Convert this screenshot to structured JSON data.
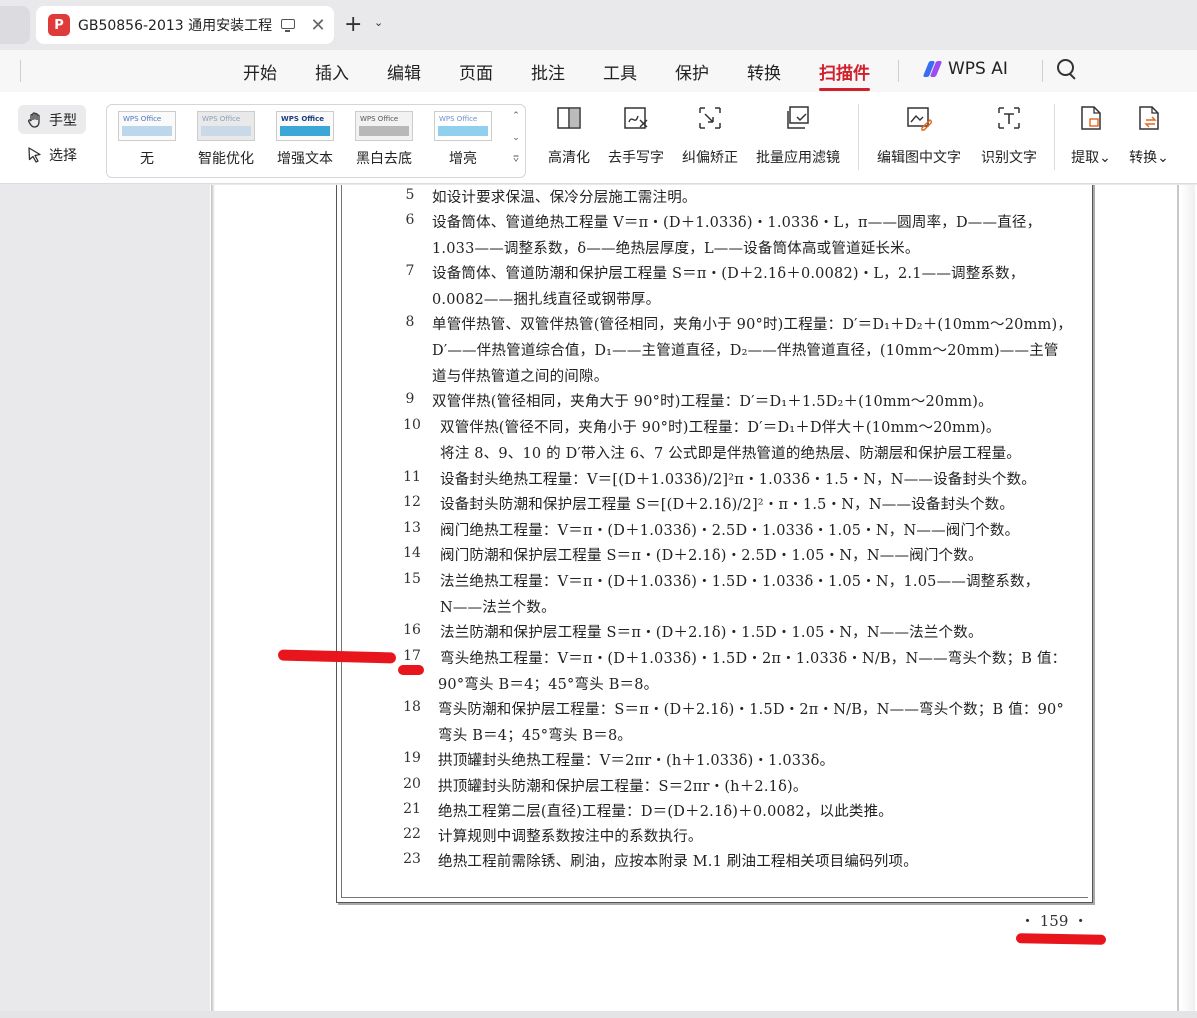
{
  "tab": {
    "title": "GB50856-2013 通用安装工程",
    "close": "✕",
    "new_tab": "+",
    "new_tab_drop": "⌄"
  },
  "menu": {
    "items": [
      "开始",
      "插入",
      "编辑",
      "页面",
      "批注",
      "工具",
      "保护",
      "转换",
      "扫描件"
    ],
    "active": "扫描件",
    "ai_label": "WPS AI"
  },
  "toolbar": {
    "hand": "手型",
    "select": "选择",
    "filter_logo": "WPS Office",
    "filters": [
      "无",
      "智能优化",
      "增强文本",
      "黑白去底",
      "增亮"
    ],
    "scroll_up": "⌃",
    "scroll_down": "⌄",
    "scroll_more": "⩢",
    "tools": [
      "高清化",
      "去手写字",
      "纠偏矫正",
      "批量应用滤镜",
      "编辑图中文字",
      "识别文字",
      "提取⌄",
      "转换⌄"
    ]
  },
  "document": {
    "lines": [
      {
        "n": "5",
        "text": "如设计要求保温、保冷分层施工需注明。"
      },
      {
        "n": "6",
        "text": "设备筒体、管道绝热工程量 V＝π・(D＋1.033δ)・1.033δ・L，π——圆周率，D——直径，"
      },
      {
        "n": "",
        "text": "1.033——调整系数，δ——绝热层厚度，L——设备筒体高或管道延长米。"
      },
      {
        "n": "7",
        "text": "设备筒体、管道防潮和保护层工程量 S＝π・(D＋2.1δ＋0.0082)・L，2.1——调整系数，"
      },
      {
        "n": "",
        "text": "0.0082——捆扎线直径或钢带厚。"
      },
      {
        "n": "8",
        "text": "单管伴热管、双管伴热管(管径相同，夹角小于 90°时)工程量：D′＝D₁＋D₂＋(10mm～20mm)，"
      },
      {
        "n": "",
        "text": "D′——伴热管道综合值，D₁——主管道直径，D₂——伴热管道直径，(10mm～20mm)——主管"
      },
      {
        "n": "",
        "text": "道与伴热管道之间的间隙。"
      },
      {
        "n": "9",
        "text": "双管伴热(管径相同，夹角大于 90°时)工程量：D′＝D₁＋1.5D₂＋(10mm～20mm)。"
      },
      {
        "n": "10",
        "text": "双管伴热(管径不同，夹角小于 90°时)工程量：D′＝D₁＋D伴大＋(10mm～20mm)。"
      },
      {
        "n": "",
        "text": "将注 8、9、10 的 D′带入注 6、7 公式即是伴热管道的绝热层、防潮层和保护层工程量。"
      },
      {
        "n": "11",
        "text": "设备封头绝热工程量：V＝[(D＋1.033δ)/2]²π・1.033δ・1.5・N，N——设备封头个数。"
      },
      {
        "n": "12",
        "text": "设备封头防潮和保护层工程量 S＝[(D＋2.1δ)/2]²・π・1.5・N，N——设备封头个数。"
      },
      {
        "n": "13",
        "text": "阀门绝热工程量：V＝π・(D＋1.033δ)・2.5D・1.033δ・1.05・N，N——阀门个数。"
      },
      {
        "n": "14",
        "text": "阀门防潮和保护层工程量 S＝π・(D＋2.1δ)・2.5D・1.05・N，N——阀门个数。"
      },
      {
        "n": "15",
        "text": "法兰绝热工程量：V＝π・(D＋1.033δ)・1.5D・1.033δ・1.05・N，1.05——调整系数，"
      },
      {
        "n": "",
        "text": "N——法兰个数。"
      },
      {
        "n": "16",
        "text": "法兰防潮和保护层工程量 S＝π・(D＋2.1δ)・1.5D・1.05・N，N——法兰个数。"
      },
      {
        "n": "17",
        "text": "弯头绝热工程量：V＝π・(D＋1.033δ)・1.5D・2π・1.033δ・N/B，N——弯头个数；B 值："
      },
      {
        "n": "",
        "text": "90°弯头 B＝4；45°弯头 B＝8。"
      },
      {
        "n": "18",
        "text": "弯头防潮和保护层工程量：S＝π・(D＋2.1δ)・1.5D・2π・N/B，N——弯头个数；B 值：90°"
      },
      {
        "n": "",
        "text": "弯头 B＝4；45°弯头 B＝8。"
      },
      {
        "n": "19",
        "text": "拱顶罐封头绝热工程量：V＝2πr・(h＋1.033δ)・1.033δ。"
      },
      {
        "n": "20",
        "text": "拱顶罐封头防潮和保护层工程量：S＝2πr・(h＋2.1δ)。"
      },
      {
        "n": "21",
        "text": "绝热工程第二层(直径)工程量：D＝(D＋2.1δ)＋0.0082，以此类推。"
      },
      {
        "n": "22",
        "text": "计算规则中调整系数按注中的系数执行。"
      },
      {
        "n": "23",
        "text": "绝热工程前需除锈、刷油，应按本附录 M.1 刷油工程相关项目编码列项。"
      }
    ],
    "page_number": "・ 159 ・"
  },
  "colors": {
    "accent": "#d0202b",
    "marker": "#e8161c"
  }
}
